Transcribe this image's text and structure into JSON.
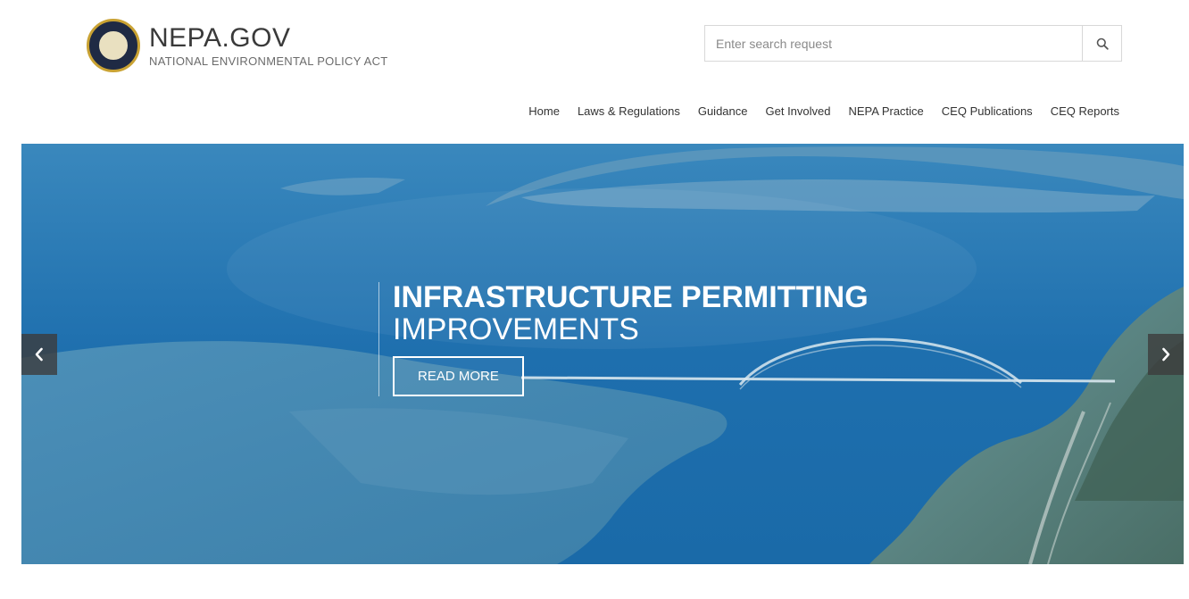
{
  "header": {
    "site_title": "NEPA.GOV",
    "site_subtitle": "NATIONAL ENVIRONMENTAL POLICY ACT"
  },
  "search": {
    "placeholder": "Enter search request",
    "value": ""
  },
  "nav": {
    "items": [
      {
        "label": "Home"
      },
      {
        "label": "Laws & Regulations"
      },
      {
        "label": "Guidance"
      },
      {
        "label": "Get Involved"
      },
      {
        "label": "NEPA Practice"
      },
      {
        "label": "CEQ Publications"
      },
      {
        "label": "CEQ Reports"
      }
    ]
  },
  "hero": {
    "headline": "INFRASTRUCTURE PERMITTING",
    "subheadline": "IMPROVEMENTS",
    "button_label": "READ MORE"
  },
  "icons": {
    "search": "search-icon",
    "prev": "chevron-left-icon",
    "next": "chevron-right-icon",
    "seal": "ceq-seal-logo"
  },
  "colors": {
    "hero_blue": "#1d72b2",
    "arrow_bg": "#3c3c3c"
  }
}
